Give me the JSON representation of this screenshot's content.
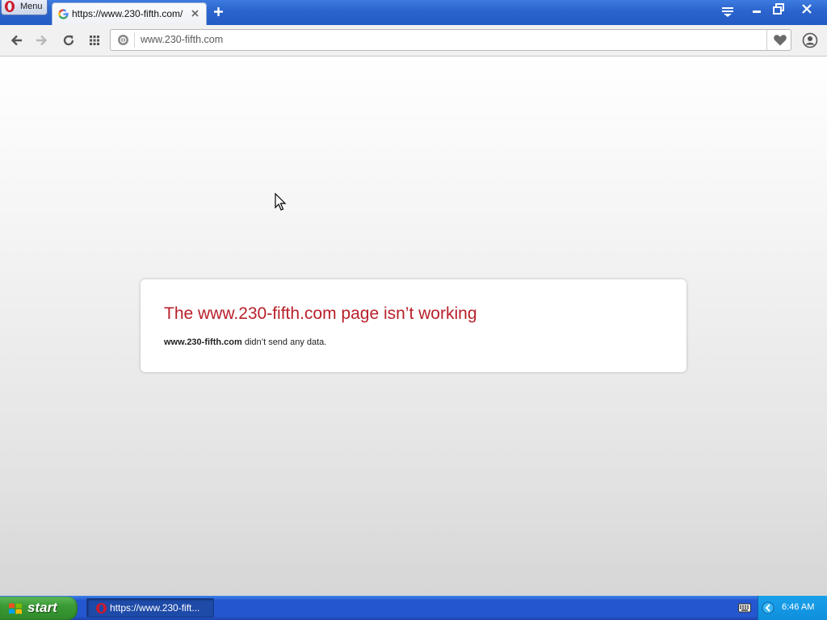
{
  "browser": {
    "menu_label": "Menu",
    "tab_title": "https://www.230-fifth.com/",
    "address": "www.230-fifth.com"
  },
  "error": {
    "title": "The www.230-fifth.com page isn’t working",
    "host": "www.230-fifth.com",
    "message": " didn’t send any data."
  },
  "taskbar": {
    "start_label": "start",
    "task_label": "https://www.230-fift...",
    "clock": "6:46 AM"
  },
  "colors": {
    "error_title": "#b8202a",
    "titlebar": "#2a64cc",
    "start_green": "#3a9a34"
  },
  "icons": [
    "opera-logo-icon",
    "google-favicon-icon",
    "tab-close-icon",
    "new-tab-icon",
    "tab-menu-icon",
    "minimize-icon",
    "maximize-icon",
    "close-window-icon",
    "back-arrow-icon",
    "forward-arrow-icon",
    "reload-icon",
    "speed-dial-icon",
    "site-info-icon",
    "heart-icon",
    "account-icon",
    "cursor-icon",
    "windows-flag-icon",
    "keyboard-icon",
    "tray-arrow-icon"
  ]
}
